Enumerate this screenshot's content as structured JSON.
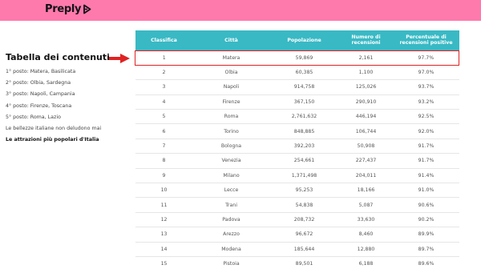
{
  "header": {
    "brand": "Preply",
    "brand_color": "#ff7aac",
    "brand_icon": "preply-logo-icon"
  },
  "toc": {
    "title": "Tabella dei contenuti",
    "items": [
      "1° posto: Matera, Basilicata",
      "2° posto: Olbia, Sardegna",
      "3° posto: Napoli, Campania",
      "4° posto: Firenze, Toscana",
      "5° posto: Roma, Lazio",
      "Le bellezze italiane non deludono mai",
      "Le attrazioni più popolari d'Italia"
    ]
  },
  "annotation": {
    "icon": "red-arrow-icon",
    "color": "#e02222"
  },
  "table": {
    "header_color": "#39b9c4",
    "columns": [
      "Classifica",
      "Città",
      "Popolazione",
      "Numero di recensioni",
      "Percentuale di recensioni positive"
    ],
    "rows": [
      [
        "1",
        "Matera",
        "59,869",
        "2,161",
        "97.7%"
      ],
      [
        "2",
        "Olbia",
        "60,385",
        "1,100",
        "97.0%"
      ],
      [
        "3",
        "Napoli",
        "914,758",
        "125,026",
        "93.7%"
      ],
      [
        "4",
        "Firenze",
        "367,150",
        "290,910",
        "93.2%"
      ],
      [
        "5",
        "Roma",
        "2,761,632",
        "446,194",
        "92.5%"
      ],
      [
        "6",
        "Torino",
        "848,885",
        "106,744",
        "92.0%"
      ],
      [
        "7",
        "Bologna",
        "392,203",
        "50,908",
        "91.7%"
      ],
      [
        "8",
        "Venezia",
        "254,661",
        "227,437",
        "91.7%"
      ],
      [
        "9",
        "Milano",
        "1,371,498",
        "204,011",
        "91.4%"
      ],
      [
        "10",
        "Lecce",
        "95,253",
        "18,166",
        "91.0%"
      ],
      [
        "11",
        "Trani",
        "54,838",
        "5,087",
        "90.6%"
      ],
      [
        "12",
        "Padova",
        "208,732",
        "33,630",
        "90.2%"
      ],
      [
        "13",
        "Arezzo",
        "96,672",
        "8,460",
        "89.9%"
      ],
      [
        "14",
        "Modena",
        "185,644",
        "12,880",
        "89.7%"
      ],
      [
        "15",
        "Pistoia",
        "89,501",
        "6,188",
        "89.6%"
      ]
    ]
  }
}
